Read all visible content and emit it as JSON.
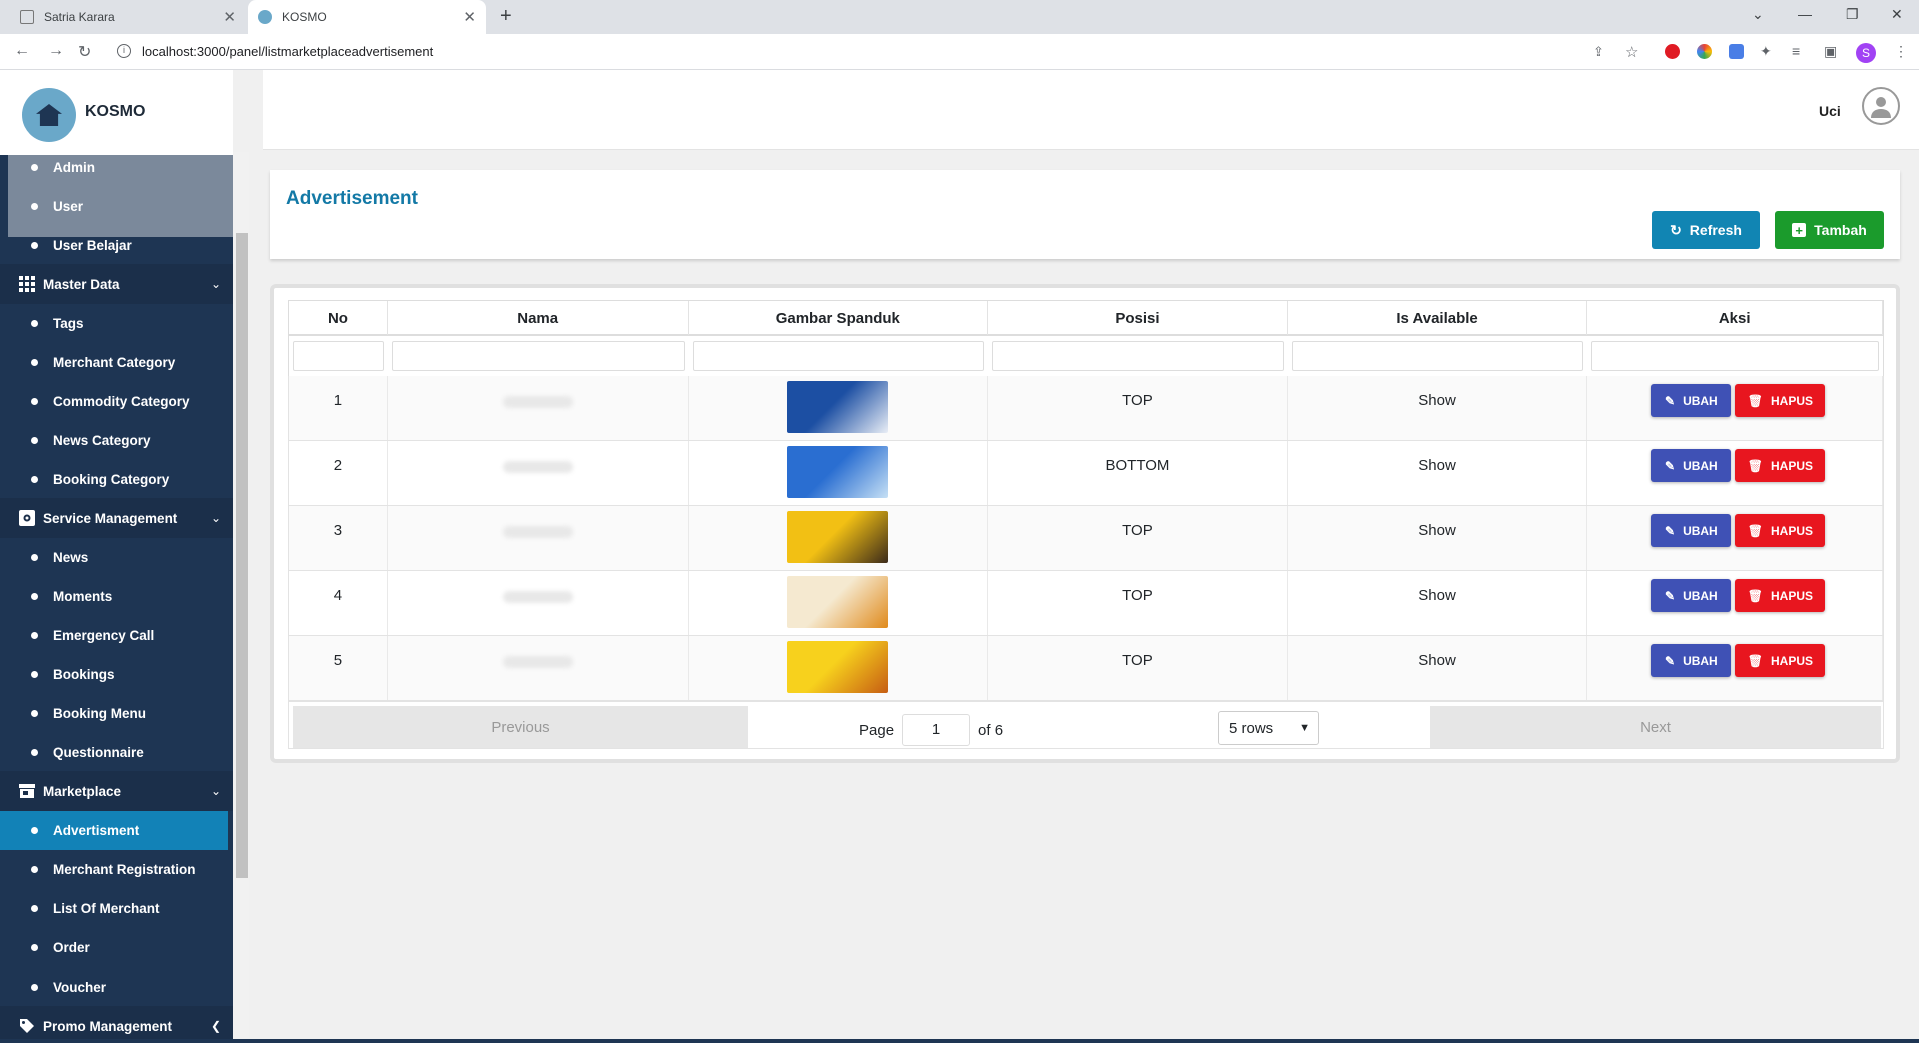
{
  "browser": {
    "tabs": [
      {
        "title": "Satria Karara",
        "active": false
      },
      {
        "title": "KOSMO",
        "active": true
      }
    ],
    "url": "localhost:3000/panel/listmarketplaceadvertisement",
    "profile_initial": "S"
  },
  "app": {
    "brand": "KOSMO",
    "user_name": "Uci"
  },
  "sidebar": {
    "items": [
      {
        "kind": "sub",
        "label": "Admin"
      },
      {
        "kind": "sub",
        "label": "User"
      },
      {
        "kind": "sub",
        "label": "User Belajar"
      },
      {
        "kind": "head",
        "label": "Master Data",
        "icon": "grid-icon"
      },
      {
        "kind": "sub",
        "label": "Tags"
      },
      {
        "kind": "sub",
        "label": "Merchant Category"
      },
      {
        "kind": "sub",
        "label": "Commodity Category"
      },
      {
        "kind": "sub",
        "label": "News Category"
      },
      {
        "kind": "sub",
        "label": "Booking Category"
      },
      {
        "kind": "head",
        "label": "Service Management",
        "icon": "gear-box-icon"
      },
      {
        "kind": "sub",
        "label": "News"
      },
      {
        "kind": "sub",
        "label": "Moments"
      },
      {
        "kind": "sub",
        "label": "Emergency Call"
      },
      {
        "kind": "sub",
        "label": "Bookings"
      },
      {
        "kind": "sub",
        "label": "Booking Menu"
      },
      {
        "kind": "sub",
        "label": "Questionnaire"
      },
      {
        "kind": "head",
        "label": "Marketplace",
        "icon": "store-icon"
      },
      {
        "kind": "sub",
        "label": "Advertisment",
        "active": true
      },
      {
        "kind": "sub",
        "label": "Merchant Registration"
      },
      {
        "kind": "sub",
        "label": "List Of Merchant"
      },
      {
        "kind": "sub",
        "label": "Order"
      },
      {
        "kind": "sub",
        "label": "Voucher"
      },
      {
        "kind": "head",
        "label": "Promo Management",
        "icon": "tag-icon",
        "collapsed": true
      }
    ]
  },
  "page": {
    "title": "Advertisement",
    "refresh_label": "Refresh",
    "add_label": "Tambah"
  },
  "table": {
    "columns": [
      "No",
      "Nama",
      "Gambar Spanduk",
      "Posisi",
      "Is Available",
      "Aksi"
    ],
    "rows": [
      {
        "no": "1",
        "posisi": "TOP",
        "available": "Show",
        "thumb_colors": [
          "#1c4fa3",
          "#e9eef6"
        ]
      },
      {
        "no": "2",
        "posisi": "BOTTOM",
        "available": "Show",
        "thumb_colors": [
          "#2a6ed1",
          "#c6e0f5"
        ]
      },
      {
        "no": "3",
        "posisi": "TOP",
        "available": "Show",
        "thumb_colors": [
          "#f2c014",
          "#3b2a1a"
        ]
      },
      {
        "no": "4",
        "posisi": "TOP",
        "available": "Show",
        "thumb_colors": [
          "#f5e9d0",
          "#e08a1c"
        ]
      },
      {
        "no": "5",
        "posisi": "TOP",
        "available": "Show",
        "thumb_colors": [
          "#f7d11d",
          "#c65d13"
        ]
      }
    ],
    "edit_label": "UBAH",
    "delete_label": "HAPUS"
  },
  "pagination": {
    "previous_label": "Previous",
    "next_label": "Next",
    "page_label": "Page",
    "current_page": "1",
    "of_label": "of 6",
    "rows_option": "5 rows"
  },
  "colors": {
    "sidebar_bg": "#1e3553",
    "accent": "#1185b3",
    "add_green": "#1b9b2c",
    "edit_blue": "#3f51b5",
    "delete_red": "#e8161f"
  }
}
